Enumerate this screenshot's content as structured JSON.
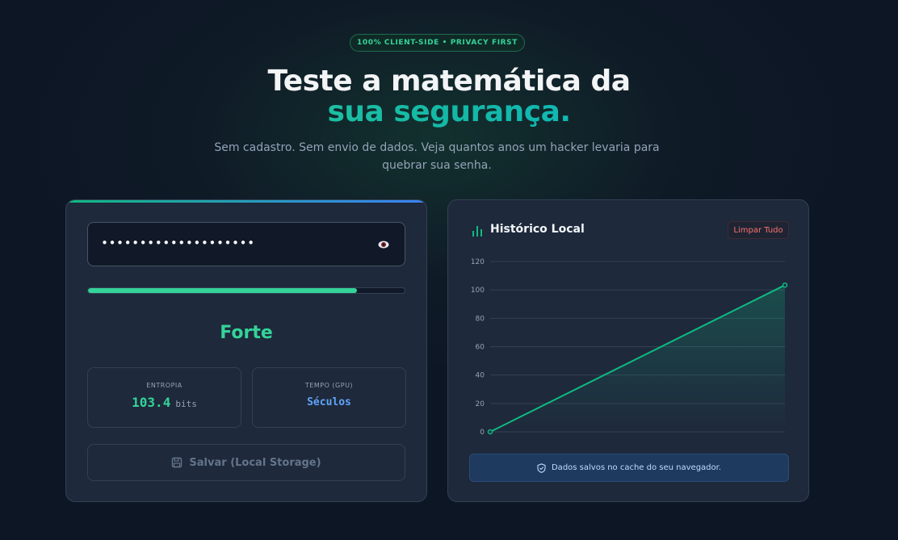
{
  "hero": {
    "badge": "100% CLIENT-SIDE • PRIVACY FIRST",
    "title_line1": "Teste a matemática da",
    "title_line2": "sua segurança.",
    "subtitle": "Sem cadastro. Sem envio de dados. Veja quantos anos um hacker levaria para quebrar sua senha."
  },
  "analyzer": {
    "password_value": "••••••••••••••••••••",
    "strength_fraction": 0.85,
    "strength_label": "Forte",
    "entropy_label": "ENTROPIA",
    "entropy_value": "103.4",
    "entropy_unit": "bits",
    "time_label": "TEMPO (GPU)",
    "time_value": "Séculos",
    "save_label": "Salvar (Local Storage)"
  },
  "history": {
    "title": "Histórico Local",
    "clear_label": "Limpar Tudo",
    "note": "Dados salvos no cache do seu navegador."
  },
  "colors": {
    "accent": "#34d399",
    "blue": "#60a5fa",
    "danger": "#f87171"
  },
  "chart_data": {
    "type": "line",
    "x": [
      1,
      2
    ],
    "series": [
      {
        "values": [
          0,
          103.4
        ]
      }
    ],
    "yticks": [
      0,
      20,
      40,
      60,
      80,
      100,
      120
    ],
    "ylim": [
      0,
      120
    ],
    "grid": true,
    "title": "",
    "xlabel": "",
    "ylabel": ""
  }
}
